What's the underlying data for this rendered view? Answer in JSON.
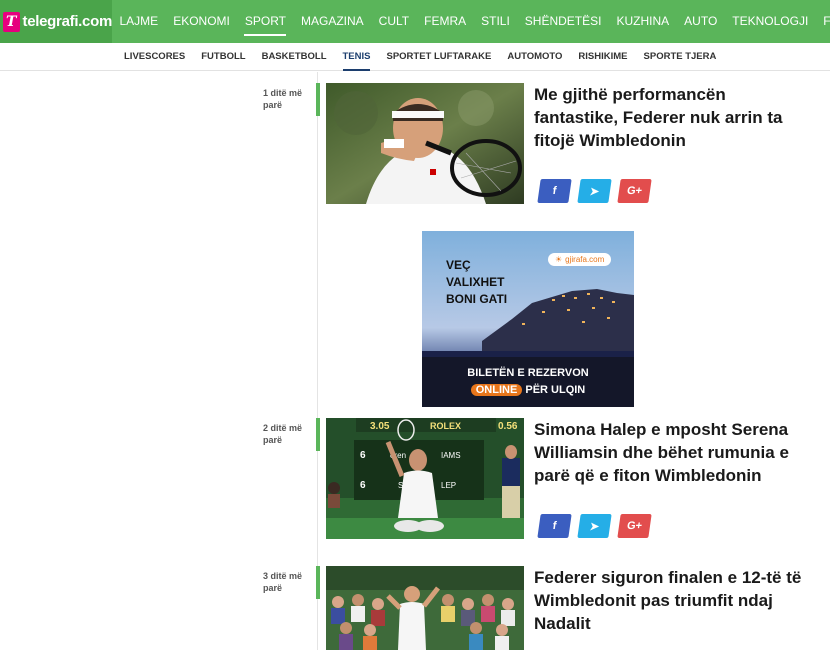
{
  "header": {
    "logo_text": "telegrafi.com",
    "logo_mark": "T",
    "nav": [
      "LAJME",
      "EKONOMI",
      "SPORT",
      "MAGAZINA",
      "CULT",
      "FEMRA",
      "STILI",
      "SHËNDETËSI",
      "KUZHINA",
      "AUTO",
      "TEKNOLOGJI",
      "FUN"
    ],
    "nav_active_label": "SPORT"
  },
  "subnav": {
    "items": [
      "LIVESCORES",
      "FUTBOLL",
      "BASKETBOLL",
      "TENIS",
      "SPORTET LUFTARAKE",
      "AUTOMOTO",
      "RISHIKIME",
      "SPORTE TJERA"
    ],
    "active_label": "TENIS"
  },
  "articles": [
    {
      "time": "1 ditë më parë",
      "title": "Me gjithë performancën fantastike, Federer nuk arrin ta fitojë Wimbledonin"
    },
    {
      "time": "2 ditë më parë",
      "title": "Simona Halep e mposht Serena Williamsin dhe bëhet rumunia e parë që e fiton Wimbledonin",
      "scoreboard": {
        "left": "3.05",
        "brand": "ROLEX",
        "right": "0.56",
        "p1": "6",
        "p2": "6",
        "n1": "eren",
        "n2": "IAMS",
        "n3": "Si",
        "n4": "LEP"
      }
    },
    {
      "time": "3 ditë më parë",
      "title": "Federer siguron finalen e 12-të të Wimbledonit pas triumfit ndaj Nadalit"
    }
  ],
  "share": {
    "facebook": "f",
    "twitter": "t",
    "google": "G+"
  },
  "ad": {
    "line1": "VEÇ",
    "line2": "VALIXHET",
    "line3": "BONI GATI",
    "brand": "gjirafa.com",
    "cta1": "BILETËN E REZERVON",
    "cta_highlight": "ONLINE",
    "cta2": "PËR ULQIN"
  },
  "colors": {
    "green": "#5ab55a",
    "navy": "#1c3e6e",
    "facebook": "#3b5ec0",
    "twitter": "#25aee7",
    "google": "#e24d4d",
    "ad_orange": "#e8761b"
  }
}
